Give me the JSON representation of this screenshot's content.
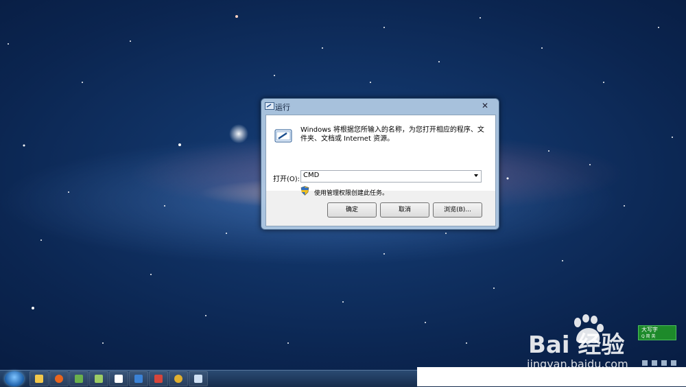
{
  "dialog": {
    "title": "运行",
    "description": "Windows 将根据您所输入的名称，为您打开相应的程序、文件夹、文档或 Internet 资源。",
    "open_label": "打开(O):",
    "command_value": "CMD",
    "admin_note": "使用管理权限创建此任务。",
    "buttons": {
      "ok": "确定",
      "cancel": "取消",
      "browse": "浏览(B)..."
    },
    "close_icon": "close-icon"
  },
  "watermark": {
    "brand": "Bai  经验",
    "url": "jingyan.baidu.com"
  },
  "ime": {
    "label": "大写字",
    "sub": "Q 简 英"
  },
  "taskbar": {
    "icons": [
      "file-explorer-icon",
      "firefox-icon",
      "app-icon",
      "app-icon",
      "document-icon",
      "media-player-icon",
      "app-icon",
      "chrome-icon",
      "run-dialog-icon"
    ]
  },
  "colors": {
    "taskbar": "#1e3a5e",
    "ime_green": "#1d8a2a",
    "dialog_frame": "#b4cde6"
  }
}
